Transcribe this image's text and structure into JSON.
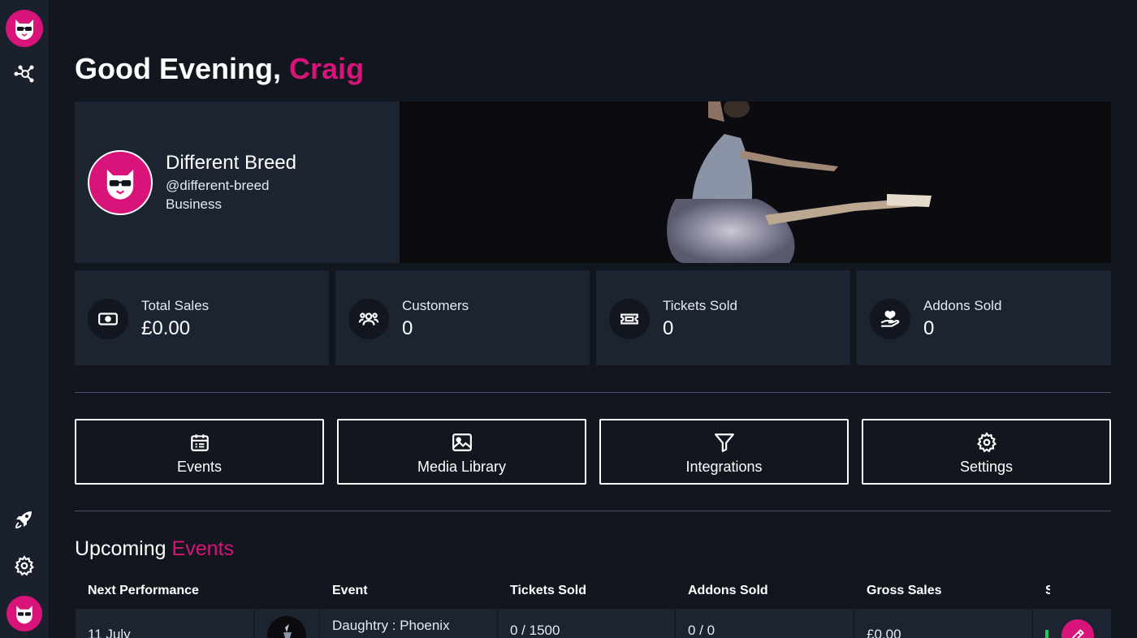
{
  "greeting": {
    "prefix": "Good Evening,",
    "name": "Craig"
  },
  "profile": {
    "name": "Different Breed",
    "handle": "@different-breed",
    "type": "Business"
  },
  "stats": [
    {
      "label": "Total Sales",
      "value": "£0.00",
      "icon": "cash-icon"
    },
    {
      "label": "Customers",
      "value": "0",
      "icon": "users-icon"
    },
    {
      "label": "Tickets Sold",
      "value": "0",
      "icon": "ticket-icon"
    },
    {
      "label": "Addons Sold",
      "value": "0",
      "icon": "hand-heart-icon"
    }
  ],
  "actions": [
    {
      "label": "Events",
      "icon": "calendar-icon"
    },
    {
      "label": "Media Library",
      "icon": "image-icon"
    },
    {
      "label": "Integrations",
      "icon": "filter-icon"
    },
    {
      "label": "Settings",
      "icon": "gear-icon"
    }
  ],
  "upcoming": {
    "title_prefix": "Upcoming",
    "title_accent": "Events",
    "columns": [
      "Next Performance",
      "Event",
      "Tickets Sold",
      "Addons Sold",
      "Gross Sales",
      "S"
    ],
    "rows": [
      {
        "date": "11 July",
        "event": "Daughtry : Phoenix",
        "tickets": "0 / 1500",
        "addons": "0 / 0",
        "gross": "£0.00"
      }
    ]
  },
  "colors": {
    "accent": "#d8137a",
    "background": "#12161e",
    "card": "#1c2431",
    "sidebar": "#1a212d"
  }
}
